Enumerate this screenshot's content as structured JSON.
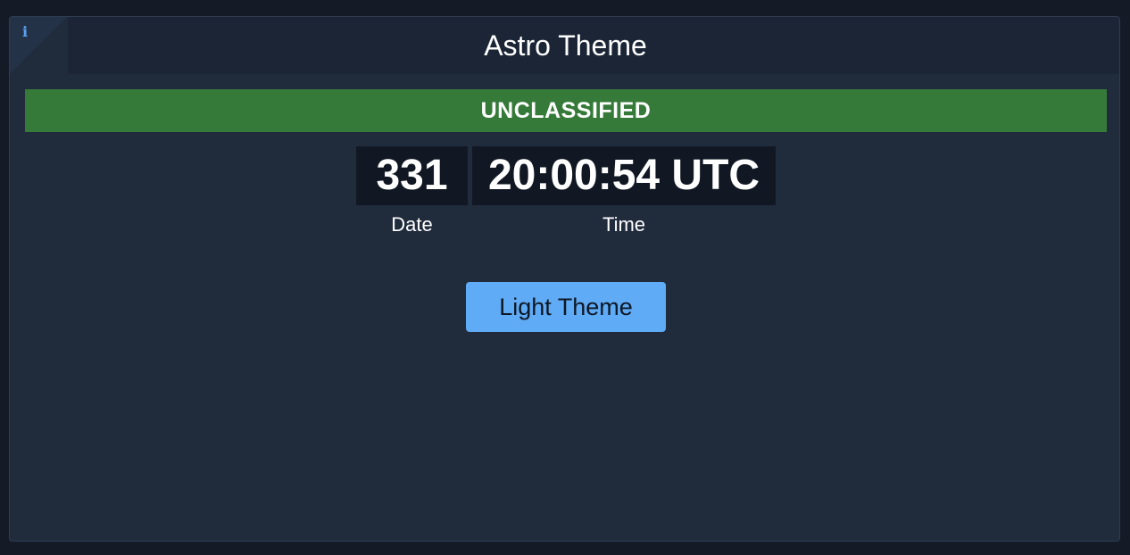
{
  "widget": {
    "title": "Astro Theme",
    "info_icon": "info-icon"
  },
  "classification": {
    "label": "UNCLASSIFIED",
    "color": "#357a39"
  },
  "clock": {
    "date_value": "331",
    "time_value": "20:00:54 UTC",
    "date_label": "Date",
    "time_label": "Time"
  },
  "actions": {
    "theme_button_label": "Light Theme",
    "theme_button_color": "#5fabf6"
  }
}
